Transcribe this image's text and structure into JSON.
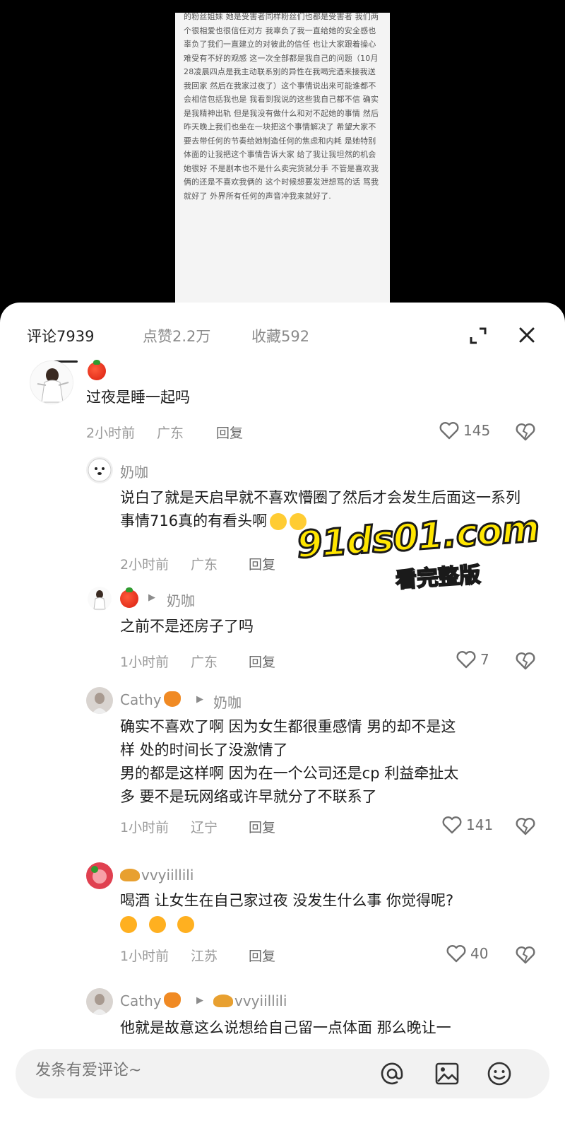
{
  "post": {
    "text": "的粉丝姐妹 她是受害者同样粉丝们也都是受害者 我们两个很相爱也很信任对方 我辜负了我一直给她的安全感也辜负了我们一直建立的对彼此的信任 也让大家跟着操心难受有不好的观感 这一次全部都是我自己的问题（10月28凌晨四点是我主动联系别的异性在我喝完酒来接我送我回家 然后在我家过夜了）这个事情说出来可能谁都不会相信包括我也是 我看到我说的这些我自己都不信 确实是我精神出轨 但是我没有做什么和对不起她的事情 然后昨天晚上我们也坐在一块把这个事情解决了 希望大家不要去带任何的节奏给她制造任何的焦虑和内耗 是她特别体面的让我把这个事情告诉大家 给了我让我坦然的机会 她很好 不是剧本也不是什么卖完货就分手 不管是喜欢我俩的还是不喜欢我俩的 这个时候想要发泄想骂的话 骂我就好了 外界所有任何的声音冲我来就好了."
  },
  "tabs": {
    "comments": "评论7939",
    "likes": "点赞2.2万",
    "favorites": "收藏592"
  },
  "comments": [
    {
      "name": "",
      "reply_to": "",
      "body": "过夜是睡一起吗",
      "time": "2小时前",
      "location": "广东",
      "reply_label": "回复",
      "likes": "145"
    },
    {
      "name": "奶咖",
      "reply_to": "",
      "body": "说白了就是天启早就不喜欢懵圈了然后才会发生后面这一系列事情716真的有看头啊",
      "time": "2小时前",
      "location": "广东",
      "reply_label": "回复",
      "likes": ""
    },
    {
      "name": "",
      "reply_to": "奶咖",
      "body": "之前不是还房子了吗",
      "time": "1小时前",
      "location": "广东",
      "reply_label": "回复",
      "likes": "7"
    },
    {
      "name": "Cathy",
      "reply_to": "奶咖",
      "body_lines": [
        "确实不喜欢了啊  因为女生都很重感情  男的却不是这",
        "样  处的时间长了没激情了",
        "男的都是这样啊 因为在一个公司还是cp  利益牵扯太",
        "多  要不是玩网络或许早就分了不联系了"
      ],
      "time": "1小时前",
      "location": "辽宁",
      "reply_label": "回复",
      "likes": "141"
    },
    {
      "name": "vvyiillili",
      "reply_to": "",
      "body": "喝酒 让女生在自己家过夜 没发生什么事 你觉得呢?",
      "time": "1小时前",
      "location": "江苏",
      "reply_label": "回复",
      "likes": "40"
    },
    {
      "name": "Cathy",
      "reply_to": "vvyiillili",
      "body": "他就是故意这么说想给自己留一点体面   那么晚让一"
    }
  ],
  "input": {
    "placeholder": "发条有爱评论~"
  },
  "watermark": {
    "main": "91ds01.com",
    "sub": "看完整版"
  },
  "icons": {
    "expand": "expand-icon",
    "close": "close-icon",
    "heart": "heart-icon",
    "dislike": "dislike-icon",
    "at": "at-icon",
    "image": "image-icon",
    "emoji": "emoji-icon"
  }
}
